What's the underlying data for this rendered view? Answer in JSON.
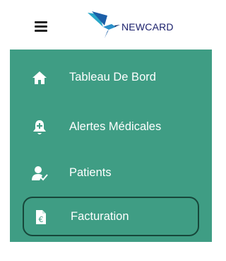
{
  "header": {
    "menu_icon": "hamburger-icon",
    "logo_icon": "hummingbird-logo",
    "logo_text": "NEWCARD"
  },
  "nav": {
    "background": "#3f9d84",
    "active_border": "#17473a",
    "items": [
      {
        "label": "Tableau De Bord",
        "icon": "home-icon"
      },
      {
        "label": "Alertes Médicales",
        "icon": "medical-bell-icon"
      },
      {
        "label": "Patients",
        "icon": "patient-check-icon"
      },
      {
        "label": "Facturation",
        "icon": "invoice-euro-icon",
        "active": true
      }
    ]
  }
}
